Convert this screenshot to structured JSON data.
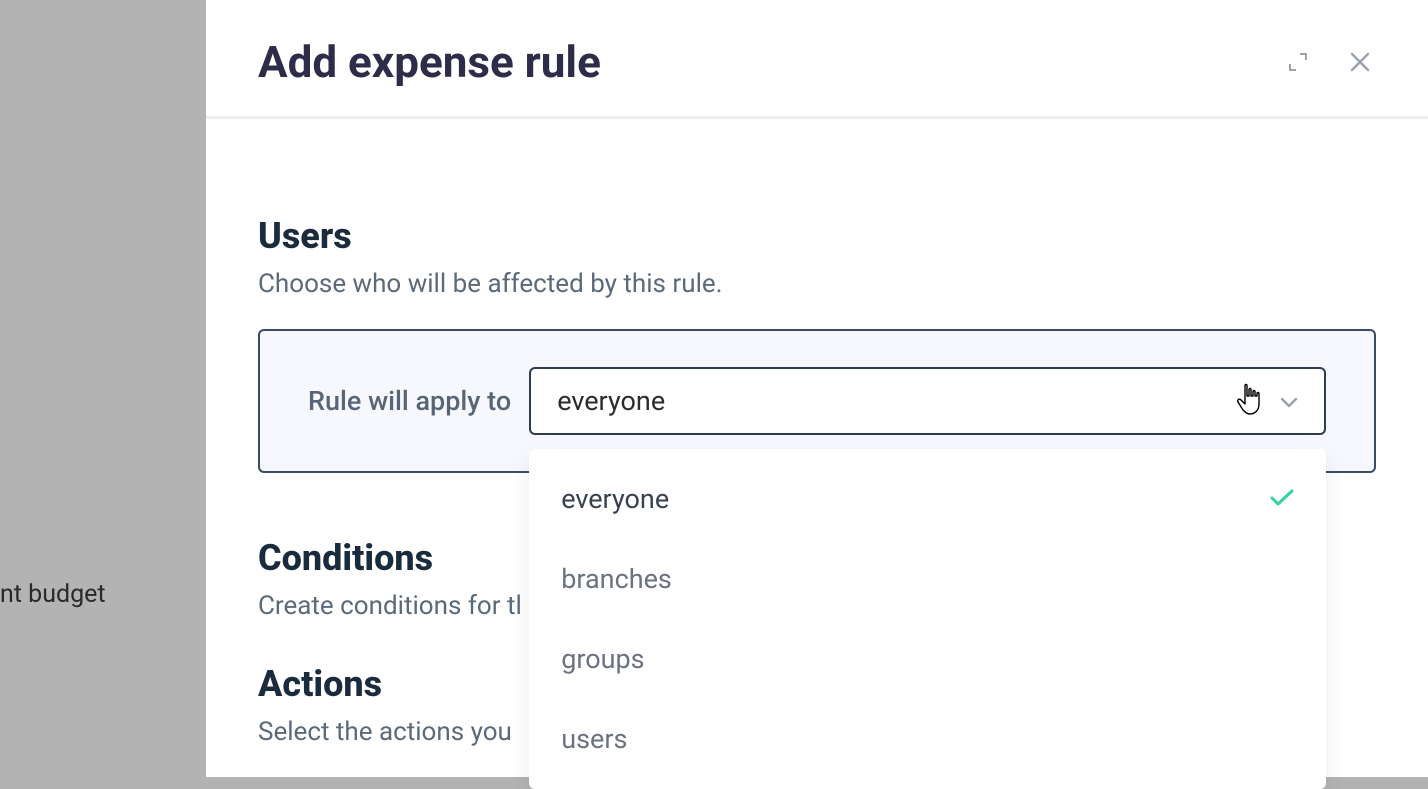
{
  "sidebar": {
    "visible_fragment": "nt budget"
  },
  "modal": {
    "title": "Add expense rule",
    "users": {
      "heading": "Users",
      "subtext": "Choose who will be affected by this rule.",
      "rule_label": "Rule will apply to",
      "selected_value": "everyone",
      "options": [
        {
          "label": "everyone",
          "selected": true
        },
        {
          "label": "branches",
          "selected": false
        },
        {
          "label": "groups",
          "selected": false
        },
        {
          "label": "users",
          "selected": false
        }
      ]
    },
    "conditions": {
      "heading": "Conditions",
      "subtext": "Create conditions for tl"
    },
    "actions": {
      "heading": "Actions",
      "subtext": "Select the actions you"
    }
  }
}
